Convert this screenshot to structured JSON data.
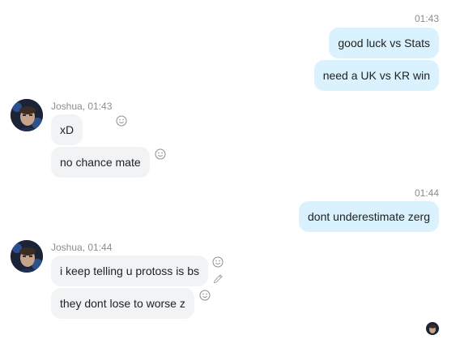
{
  "conversation": {
    "groups": [
      {
        "sender": "",
        "time": "01:43",
        "messages": [
          "good luck vs Stats",
          "need a UK vs KR win"
        ]
      },
      {
        "sender": "Joshua, 01:43",
        "messages": [
          "xD",
          "no chance mate"
        ]
      },
      {
        "sender": "",
        "time": "01:44",
        "messages": [
          "dont underestimate zerg"
        ]
      },
      {
        "sender": "Joshua, 01:44",
        "messages": [
          "i keep telling u protoss is bs",
          "they dont lose to worse z"
        ]
      }
    ]
  },
  "icons": {
    "reaction": "smiley-icon",
    "edit": "pencil-icon",
    "read_receipt": "avatar-seen-icon"
  },
  "colors": {
    "outgoing_bubble": "#d9f2fd",
    "incoming_bubble": "#f1f3f5",
    "timestamp": "#8a8d91"
  }
}
